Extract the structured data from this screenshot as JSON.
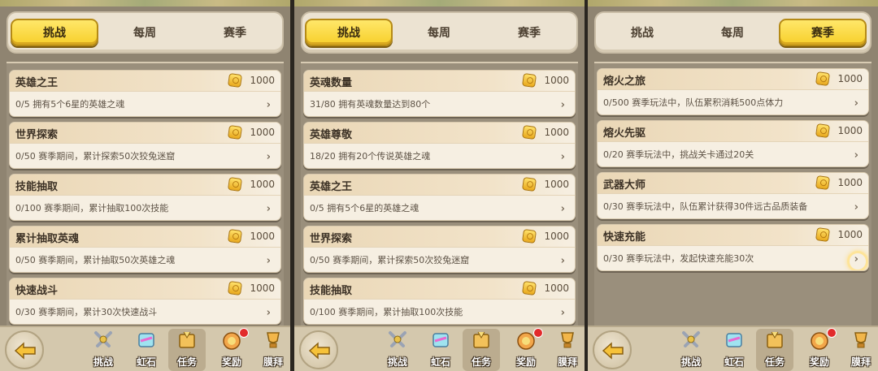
{
  "colors": {
    "active_tab": "#f7cf2a",
    "card_bg": "#f6efe2",
    "panel_bg": "#8f8471",
    "badge": "#e22b2b"
  },
  "panels": [
    {
      "tabs": [
        "挑战",
        "每周",
        "赛季"
      ],
      "active_tab": "挑战",
      "cards": [
        {
          "title": "英雄之王",
          "reward": "1000",
          "desc": "0/5 拥有5个6星的英雄之魂"
        },
        {
          "title": "世界探索",
          "reward": "1000",
          "desc": "0/50 赛季期间，累计探索50次狡兔迷窟"
        },
        {
          "title": "技能抽取",
          "reward": "1000",
          "desc": "0/100 赛季期间，累计抽取100次技能"
        },
        {
          "title": "累计抽取英魂",
          "reward": "1000",
          "desc": "0/50 赛季期间，累计抽取50次英雄之魂"
        },
        {
          "title": "快速战斗",
          "reward": "1000",
          "desc": "0/30 赛季期间，累计30次快速战斗"
        }
      ]
    },
    {
      "tabs": [
        "挑战",
        "每周",
        "赛季"
      ],
      "active_tab": "挑战",
      "cards": [
        {
          "title": "英魂数量",
          "reward": "1000",
          "desc": "31/80 拥有英魂数量达到80个"
        },
        {
          "title": "英雄尊敬",
          "reward": "1000",
          "desc": "18/20 拥有20个传说英雄之魂"
        },
        {
          "title": "英雄之王",
          "reward": "1000",
          "desc": "0/5 拥有5个6星的英雄之魂"
        },
        {
          "title": "世界探索",
          "reward": "1000",
          "desc": "0/50 赛季期间，累计探索50次狡兔迷窟"
        },
        {
          "title": "技能抽取",
          "reward": "1000",
          "desc": "0/100 赛季期间，累计抽取100次技能"
        }
      ]
    },
    {
      "tabs": [
        "挑战",
        "每周",
        "赛季"
      ],
      "active_tab": "赛季",
      "cards": [
        {
          "title": "熔火之旅",
          "reward": "1000",
          "desc": "0/500 赛季玩法中，队伍累积消耗500点体力"
        },
        {
          "title": "熔火先驱",
          "reward": "1000",
          "desc": "0/20 赛季玩法中，挑战关卡通过20关"
        },
        {
          "title": "武器大师",
          "reward": "1000",
          "desc": "0/30 赛季玩法中，队伍累计获得30件远古品质装备"
        },
        {
          "title": "快速充能",
          "reward": "1000",
          "desc": "0/30 赛季玩法中，发起快速充能30次"
        }
      ]
    }
  ],
  "bottom_nav": [
    {
      "label": "挑战",
      "icon": "crossed-swords-icon",
      "badge": false
    },
    {
      "label": "虹石",
      "icon": "rainbow-gem-icon",
      "badge": false
    },
    {
      "label": "任务",
      "icon": "quest-scroll-icon",
      "badge": false
    },
    {
      "label": "奖励",
      "icon": "reward-chest-icon",
      "badge": true
    },
    {
      "label": "膜拜",
      "icon": "trophy-icon",
      "badge": false
    }
  ],
  "back_button": {
    "icon": "back-arrow-icon"
  }
}
